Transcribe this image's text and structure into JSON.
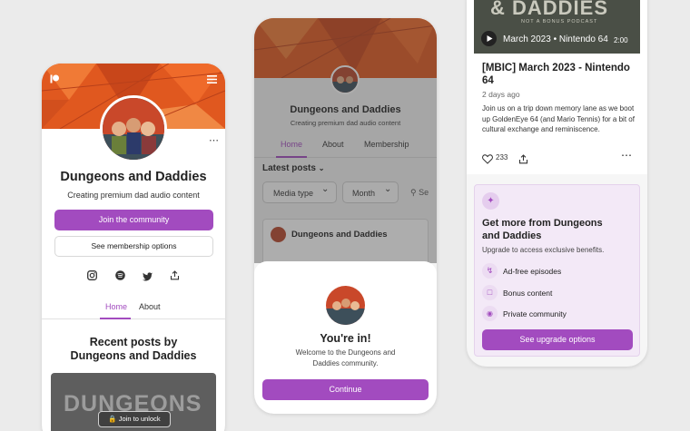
{
  "creator": {
    "name": "Dungeons and Daddies",
    "tagline": "Creating premium dad audio content"
  },
  "profile_screen": {
    "join_button": "Join the community",
    "membership_button": "See membership options",
    "social_icons": [
      "instagram-icon",
      "spotify-icon",
      "twitter-icon",
      "share-icon"
    ],
    "tabs": [
      "Home",
      "About"
    ],
    "active_tab": "Home",
    "recent_posts_heading": "Recent posts by Dungeons and Daddies",
    "locked_post_button": "Join to unlock",
    "locked_post_art_text": "DUNGEONS"
  },
  "joined_screen": {
    "tabs": [
      "Home",
      "About",
      "Membership"
    ],
    "active_tab": "Home",
    "latest_posts_label": "Latest posts",
    "filters": [
      "Media type",
      "Month",
      "Se"
    ],
    "post_preview_title": "Dungeons and Daddies",
    "modal": {
      "title": "You're in!",
      "message": "Welcome to the Dungeons and Daddies community.",
      "button": "Continue"
    }
  },
  "post_screen": {
    "art_title": "& DADDIES",
    "art_subtitle": "NOT A BONUS PODCAST",
    "media_caption": "March 2023 • Nintendo 64",
    "duration": "2:00",
    "post_title": "[MBIC] March 2023 - Nintendo 64",
    "post_age": "2 days ago",
    "post_body": "Join us on a trip down memory lane as we boot up GoldenEye 64 (and Mario Tennis) for a bit of cultural exchange and reminiscence.",
    "likes": "233",
    "upsell": {
      "title": "Get more from Dungeons and Daddies",
      "subtitle": "Upgrade to access exclusive benefits.",
      "features": [
        "Ad-free episodes",
        "Bonus content",
        "Private community"
      ],
      "button": "See upgrade options"
    }
  },
  "colors": {
    "accent": "#a24bbf",
    "banner": "#e0581f",
    "upsell_bg": "#f3e9f7",
    "background": "#ebebeb"
  }
}
